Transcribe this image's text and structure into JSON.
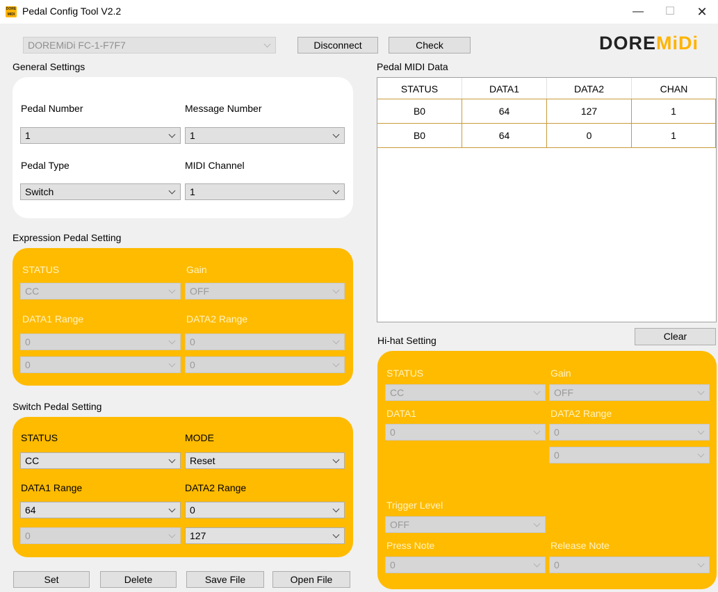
{
  "window": {
    "app_icon_text": "DORE MIDI",
    "title": "Pedal Config Tool V2.2",
    "minimize": "—",
    "maximize": "☐",
    "close": "✕"
  },
  "toolbar": {
    "device": "DOREMiDi FC-1-F7F7",
    "disconnect": "Disconnect",
    "check": "Check",
    "logo_main": "DORE",
    "logo_accent": "MiDi"
  },
  "general": {
    "title": "General Settings",
    "pedal_number_label": "Pedal Number",
    "pedal_number": "1",
    "message_number_label": "Message Number",
    "message_number": "1",
    "pedal_type_label": "Pedal Type",
    "pedal_type": "Switch",
    "midi_channel_label": "MIDI Channel",
    "midi_channel": "1"
  },
  "expression": {
    "title": "Expression Pedal Setting",
    "status_label": "STATUS",
    "status": "CC",
    "gain_label": "Gain",
    "gain": "OFF",
    "data1_label": "DATA1 Range",
    "data1_min": "0",
    "data1_max": "0",
    "data2_label": "DATA2 Range",
    "data2_min": "0",
    "data2_max": "0"
  },
  "switch": {
    "title": "Switch Pedal Setting",
    "status_label": "STATUS",
    "status": "CC",
    "mode_label": "MODE",
    "mode": "Reset",
    "data1_label": "DATA1 Range",
    "data1_min": "64",
    "data1_max": "0",
    "data2_label": "DATA2 Range",
    "data2_min": "0",
    "data2_max": "127"
  },
  "bottom_buttons": {
    "set": "Set",
    "delete": "Delete",
    "save": "Save File",
    "open": "Open File"
  },
  "midi": {
    "title": "Pedal MIDI Data",
    "columns": [
      "STATUS",
      "DATA1",
      "DATA2",
      "CHAN"
    ],
    "rows": [
      [
        "B0",
        "64",
        "127",
        "1"
      ],
      [
        "B0",
        "64",
        "0",
        "1"
      ]
    ],
    "clear": "Clear"
  },
  "hihat": {
    "title": "Hi-hat Setting",
    "status_label": "STATUS",
    "status": "CC",
    "gain_label": "Gain",
    "gain": "OFF",
    "data1_label": "DATA1",
    "data1": "0",
    "data2_label": "DATA2 Range",
    "data2_min": "0",
    "data2_max": "0",
    "trigger_label": "Trigger Level",
    "trigger": "OFF",
    "press_label": "Press Note",
    "press": "0",
    "release_label": "Release Note",
    "release": "0"
  }
}
